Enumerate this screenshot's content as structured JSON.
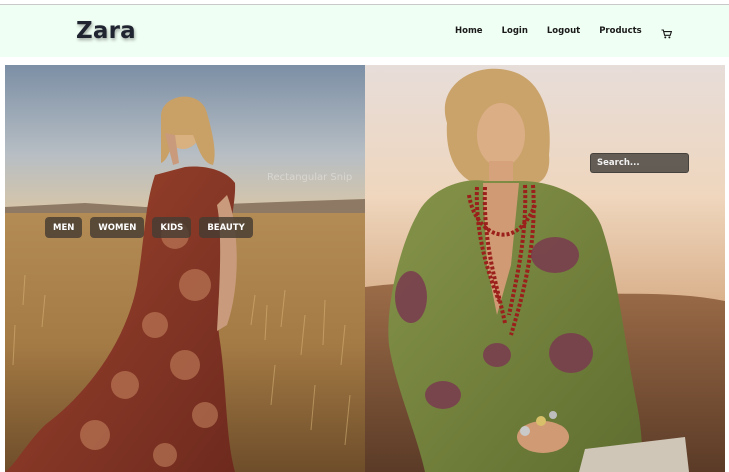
{
  "brand": "Zara",
  "nav": {
    "home": "Home",
    "login": "Login",
    "logout": "Logout",
    "products": "Products",
    "cart_icon": "shopping-cart-icon"
  },
  "hero": {
    "watermark": "Rectangular Snip",
    "categories": [
      "MEN",
      "WOMEN",
      "KIDS",
      "BEAUTY"
    ],
    "search_placeholder": "Search..."
  }
}
